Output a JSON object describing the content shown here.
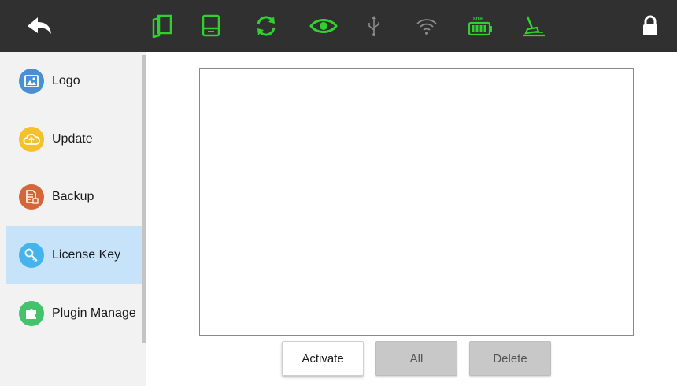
{
  "colors": {
    "topbar": "#303030",
    "accent_green": "#2fd12f",
    "sidebar_bg": "#f2f2f2",
    "sidebar_active": "#c6e3f9"
  },
  "topbar": {
    "icons": [
      "back-icon",
      "manual-icon",
      "device-icon",
      "sync-icon",
      "eye-icon",
      "usb-icon",
      "wifi-icon",
      "battery-icon",
      "cleaning-icon",
      "lock-icon"
    ],
    "battery_label": "80%"
  },
  "sidebar": {
    "items": [
      {
        "label": "Logo",
        "icon": "image-icon",
        "color": "#4a8fd6"
      },
      {
        "label": "Update",
        "icon": "cloud-upload-icon",
        "color": "#f3c12d"
      },
      {
        "label": "Backup",
        "icon": "backup-doc-icon",
        "color": "#d2683a"
      },
      {
        "label": "License Key",
        "icon": "key-icon",
        "color": "#45b3ee",
        "active": true
      },
      {
        "label": "Plugin Manage",
        "icon": "puzzle-icon",
        "color": "#45c26c"
      }
    ]
  },
  "main": {
    "license_list": []
  },
  "buttons": {
    "activate": "Activate",
    "all": "All",
    "delete": "Delete"
  }
}
